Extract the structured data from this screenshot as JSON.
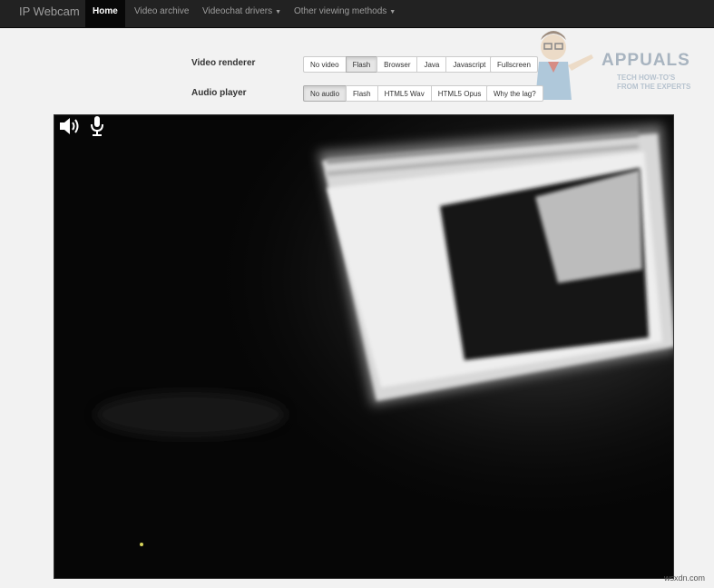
{
  "navbar": {
    "brand": "IP Webcam",
    "items": [
      {
        "label": "Home",
        "active": true,
        "dropdown": false
      },
      {
        "label": "Video archive",
        "active": false,
        "dropdown": false
      },
      {
        "label": "Videochat drivers",
        "active": false,
        "dropdown": true
      },
      {
        "label": "Other viewing methods",
        "active": false,
        "dropdown": true
      }
    ]
  },
  "video_renderer": {
    "label": "Video renderer",
    "options": [
      "No video",
      "Flash",
      "Browser",
      "Java",
      "Javascript"
    ],
    "selected": "Flash",
    "fullscreen_label": "Fullscreen"
  },
  "audio_player": {
    "label": "Audio player",
    "options": [
      "No audio",
      "Flash",
      "HTML5 Wav",
      "HTML5 Opus"
    ],
    "selected": "No audio",
    "lag_label": "Why the lag?"
  },
  "logo": {
    "text": "APPUALS",
    "tagline": "TECH HOW-TO'S FROM THE EXPERTS"
  },
  "video": {
    "controls": [
      "speaker-icon",
      "microphone-icon"
    ]
  },
  "watermark": "wsxdn.com",
  "colors": {
    "navbar_bg": "#222222",
    "navbar_active_bg": "#080808",
    "page_bg": "#f2f2f2",
    "video_bg": "#060606"
  }
}
